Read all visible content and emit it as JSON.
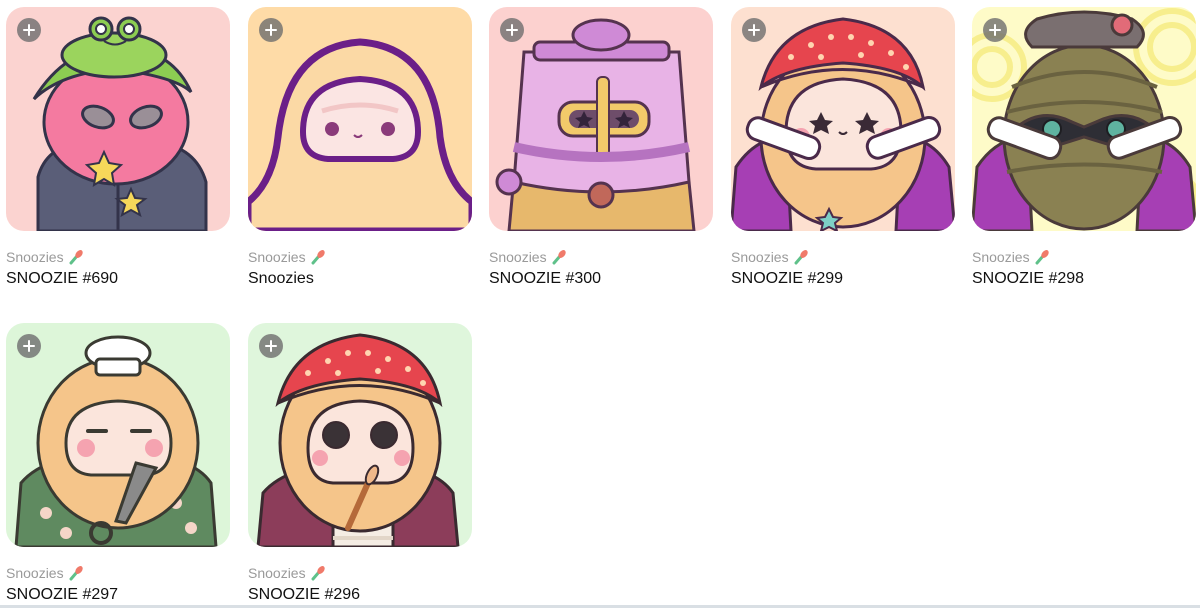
{
  "colors": {
    "card_backgrounds": [
      "#fbd3d0",
      "#fedba7",
      "#fcd1cf",
      "#fde0d0",
      "#fefbc8",
      "#ddf6d9",
      "#dff6dc"
    ],
    "collection_text": "#9a9a9a",
    "name_text": "#111111"
  },
  "icons": {
    "add": "plus-icon",
    "collection_badge": "paintbrush-icon"
  },
  "items": [
    {
      "collection": "Snoozies",
      "name": "SNOOZIE #690",
      "art": "frog-hat-alien-snoozie"
    },
    {
      "collection": "Snoozies",
      "name": "Snoozies",
      "art": "purple-outline-snoozie"
    },
    {
      "collection": "Snoozies",
      "name": "SNOOZIE #300",
      "art": "knight-helmet-snoozie"
    },
    {
      "collection": "Snoozies",
      "name": "SNOOZIE #299",
      "art": "red-beanie-star-eyes-snoozie"
    },
    {
      "collection": "Snoozies",
      "name": "SNOOZIE #298",
      "art": "masked-beret-snoozie"
    },
    {
      "collection": "Snoozies",
      "name": "SNOOZIE #297",
      "art": "chef-hat-kunai-snoozie"
    },
    {
      "collection": "Snoozies",
      "name": "SNOOZIE #296",
      "art": "red-beanie-painter-snoozie"
    }
  ]
}
